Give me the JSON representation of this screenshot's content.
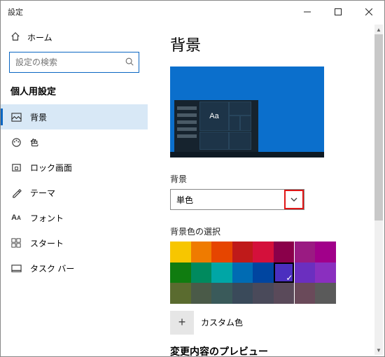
{
  "window": {
    "title": "設定"
  },
  "sidebar": {
    "home": "ホーム",
    "search_placeholder": "設定の検索",
    "section": "個人用設定",
    "items": [
      {
        "label": "背景",
        "selected": true
      },
      {
        "label": "色"
      },
      {
        "label": "ロック画面"
      },
      {
        "label": "テーマ"
      },
      {
        "label": "フォント"
      },
      {
        "label": "スタート"
      },
      {
        "label": "タスク バー"
      }
    ]
  },
  "main": {
    "heading": "背景",
    "preview_tile_text": "Aa",
    "bg_label": "背景",
    "bg_value": "単色",
    "swatch_label": "背景色の選択",
    "colors": [
      "#f7c600",
      "#ef7b00",
      "#e64500",
      "#bf1a1a",
      "#d4103b",
      "#8a004a",
      "#9a1b82",
      "#a1008a",
      "#107c10",
      "#008a5e",
      "#00a6a6",
      "#006bb3",
      "#0045a0",
      "#4b2fbf",
      "#6b2fbf",
      "#8a2fbf",
      "#5a6b2f",
      "#4a5a48",
      "#3a5a5a",
      "#3a4a5a",
      "#4a4a5a",
      "#5a4a5a",
      "#6a4a5a",
      "#5a5a5a"
    ],
    "selected_color_index": 13,
    "custom_label": "カスタム色",
    "preview_heading": "変更内容のプレビュー"
  }
}
